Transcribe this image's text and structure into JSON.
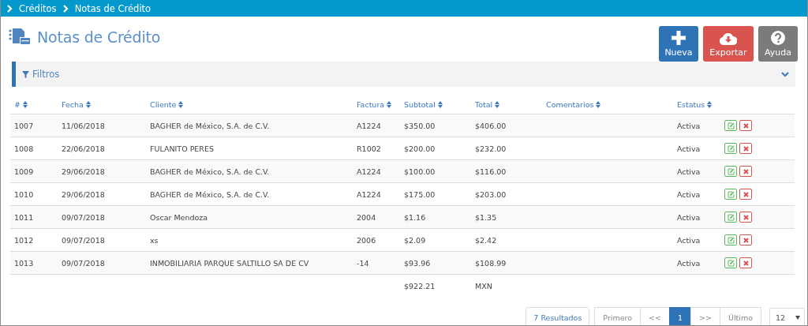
{
  "breadcrumb": [
    {
      "label": "Créditos"
    },
    {
      "label": "Notas de Crédito"
    }
  ],
  "title": "Notas de Crédito",
  "buttons": [
    {
      "kind": "new",
      "label": "Nueva"
    },
    {
      "kind": "export",
      "label": "Exportar"
    },
    {
      "kind": "help",
      "label": "Ayuda"
    }
  ],
  "filters": {
    "label": "Filtros",
    "expanded": false
  },
  "table": {
    "columns": [
      "#",
      "Fecha",
      "Cliente",
      "Factura",
      "Subtotal",
      "Total",
      "Comentarios",
      "Estatus"
    ],
    "rows": [
      {
        "cells": [
          "1007",
          "11/06/2018",
          "BAGHER de México, S.A. de C.V.",
          "A1224",
          "$350.00",
          "$406.00",
          "",
          "Activa"
        ]
      },
      {
        "cells": [
          "1008",
          "22/06/2018",
          "FULANITO PERES",
          "R1002",
          "$200.00",
          "$232.00",
          "",
          "Activa"
        ]
      },
      {
        "cells": [
          "1009",
          "29/06/2018",
          "BAGHER de México, S.A. de C.V.",
          "A1224",
          "$100.00",
          "$116.00",
          "",
          "Activa"
        ]
      },
      {
        "cells": [
          "1010",
          "29/06/2018",
          "BAGHER de México, S.A. de C.V.",
          "A1224",
          "$175.00",
          "$203.00",
          "",
          "Activa"
        ]
      },
      {
        "cells": [
          "1011",
          "09/07/2018",
          "Oscar Mendoza",
          "2004",
          "$1.16",
          "$1.35",
          "",
          "Activa"
        ]
      },
      {
        "cells": [
          "1012",
          "09/07/2018",
          "xs",
          "2006",
          "$2.09",
          "$2.42",
          "",
          "Activa"
        ]
      },
      {
        "cells": [
          "1013",
          "09/07/2018",
          "INMOBILIARIA PARQUE SALTILLO SA DE CV",
          "-14",
          "$93.96",
          "$108.99",
          "",
          "Activa"
        ]
      }
    ],
    "totals": {
      "subtotal": "$922.21",
      "currency": "MXN"
    }
  },
  "pagination": {
    "results": "7 Resultados",
    "first": "Primero",
    "prev": "<<",
    "pages": [
      {
        "label": "1",
        "selected": true
      }
    ],
    "next": ">>",
    "last": "Último",
    "page_size": "12"
  }
}
